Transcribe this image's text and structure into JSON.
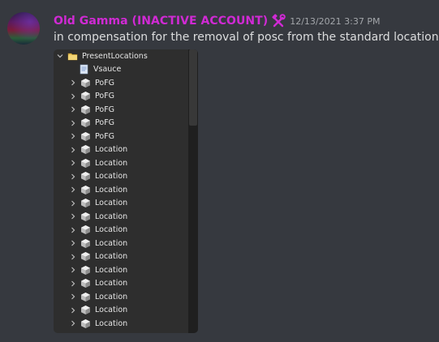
{
  "message": {
    "username": "Old Gamma (INACTIVE ACCOUNT)",
    "badge_icon": "hammer-wrench-icon",
    "timestamp": "12/13/2021 3:37 PM",
    "text": "in compensation for the removal of posc from the standard locations"
  },
  "explorer": {
    "root": {
      "label": "PresentLocations",
      "icon": "folder-icon",
      "expanded": true
    },
    "script": {
      "label": "Vsauce",
      "icon": "script-icon"
    },
    "items": [
      {
        "label": "PoFG",
        "icon": "model-icon"
      },
      {
        "label": "PoFG",
        "icon": "model-icon"
      },
      {
        "label": "PoFG",
        "icon": "model-icon"
      },
      {
        "label": "PoFG",
        "icon": "model-icon"
      },
      {
        "label": "PoFG",
        "icon": "model-icon"
      },
      {
        "label": "Location",
        "icon": "model-icon"
      },
      {
        "label": "Location",
        "icon": "model-icon"
      },
      {
        "label": "Location",
        "icon": "model-icon"
      },
      {
        "label": "Location",
        "icon": "model-icon"
      },
      {
        "label": "Location",
        "icon": "model-icon"
      },
      {
        "label": "Location",
        "icon": "model-icon"
      },
      {
        "label": "Location",
        "icon": "model-icon"
      },
      {
        "label": "Location",
        "icon": "model-icon"
      },
      {
        "label": "Location",
        "icon": "model-icon"
      },
      {
        "label": "Location",
        "icon": "model-icon"
      },
      {
        "label": "Location",
        "icon": "model-icon"
      },
      {
        "label": "Location",
        "icon": "model-icon"
      },
      {
        "label": "Location",
        "icon": "model-icon"
      },
      {
        "label": "Location",
        "icon": "model-icon"
      }
    ]
  },
  "colors": {
    "background": "#36393f",
    "username": "#d02ad4",
    "text": "#dcddde",
    "timestamp": "#a3a6aa",
    "explorer_bg": "#2e2e2e"
  }
}
